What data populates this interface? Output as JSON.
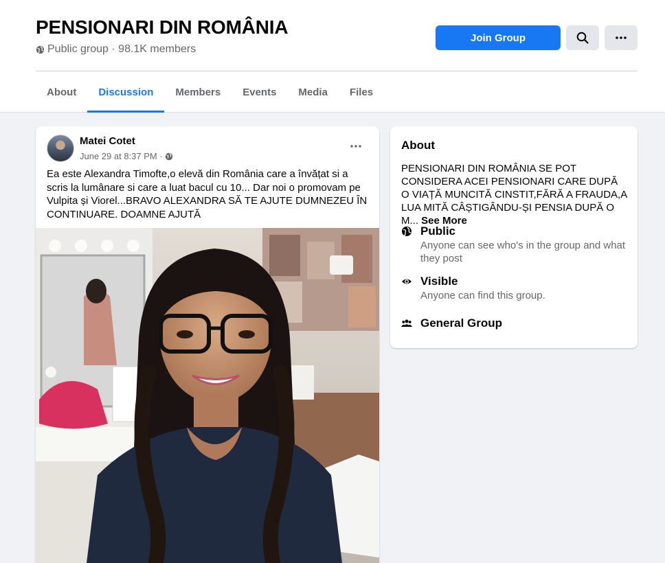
{
  "group": {
    "title": "PENSIONARI DIN ROMÂNIA",
    "meta": "Public group · 98.1K members",
    "join_label": "Join Group"
  },
  "tabs": [
    {
      "label": "About"
    },
    {
      "label": "Discussion",
      "active": true
    },
    {
      "label": "Members"
    },
    {
      "label": "Events"
    },
    {
      "label": "Media"
    },
    {
      "label": "Files"
    }
  ],
  "post": {
    "author": "Matei Cotet",
    "time": "June 29 at 8:37 PM ·",
    "text": "Ea este Alexandra Timofte,o elevă din România care a învățat si a scris la lumânare si care a luat bacul cu 10... Dar noi o promovam pe Vulpita și Viorel...BRAVO ALEXANDRA SĂ TE AJUTE DUMNEZEU ÎN CONTINUARE. DOAMNE AJUTĂ",
    "photo_alt": "Smiling young woman with glasses and braided hair"
  },
  "about": {
    "title": "About",
    "description": "PENSIONARI DIN ROMÂNIA SE POT CONSIDERA ACEI PENSIONARI CARE DUPĂ O VIAȚĂ MUNCITĂ CINSTIT,FĂRĂ A FRAUDA,A LUA MITĂ CÂȘTIGÂNDU-ȘI PENSIA DUPĂ O M...",
    "see_more": "See More",
    "public_title": "Public",
    "public_desc": "Anyone can see who's in the group and what they post",
    "visible_title": "Visible",
    "visible_desc": "Anyone can find this group.",
    "general_title": "General Group"
  },
  "colors": {
    "accent": "#1877f2",
    "background": "#f0f2f5",
    "secondary_text": "#65676b"
  },
  "icons": {
    "privacy": "globe-icon",
    "search": "search-icon",
    "more": "more-icon",
    "visible": "eye-icon",
    "group": "people-icon"
  }
}
